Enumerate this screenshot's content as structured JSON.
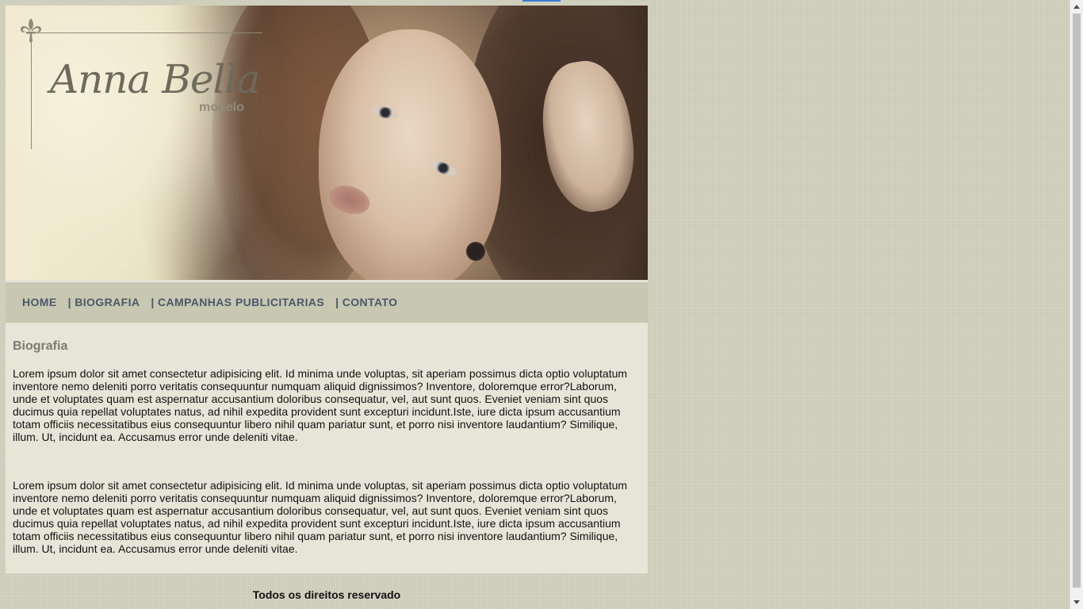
{
  "banner": {
    "brand_name": "Anna Bella",
    "brand_subtitle": "modelo",
    "image_alt": "Model portrait"
  },
  "nav": {
    "items": [
      {
        "label": "HOME"
      },
      {
        "label": "| BIOGRAFIA"
      },
      {
        "label": "| CAMPANHAS PUBLICITARIAS"
      },
      {
        "label": "| CONTATO"
      }
    ]
  },
  "content": {
    "heading": "Biografia",
    "paragraphs": [
      "Lorem ipsum dolor sit amet consectetur adipisicing elit. Id minima unde voluptas, sit aperiam possimus dicta optio voluptatum inventore nemo deleniti porro veritatis consequuntur numquam aliquid dignissimos? Inventore, doloremque error?Laborum, unde et voluptates quam est aspernatur accusantium doloribus consequatur, vel, aut sunt quos. Eveniet veniam sint quos ducimus quia repellat voluptates natus, ad nihil expedita provident sunt excepturi incidunt.Iste, iure dicta ipsum accusantium totam officiis necessitatibus eius consequuntur libero nihil quam pariatur sunt, et porro nisi inventore laudantium? Similique, illum. Ut, incidunt ea. Accusamus error unde deleniti vitae.",
      "Lorem ipsum dolor sit amet consectetur adipisicing elit. Id minima unde voluptas, sit aperiam possimus dicta optio voluptatum inventore nemo deleniti porro veritatis consequuntur numquam aliquid dignissimos? Inventore, doloremque error?Laborum, unde et voluptates quam est aspernatur accusantium doloribus consequatur, vel, aut sunt quos. Eveniet veniam sint quos ducimus quia repellat voluptates natus, ad nihil expedita provident sunt excepturi incidunt.Iste, iure dicta ipsum accusantium totam officiis necessitatibus eius consequuntur libero nihil quam pariatur sunt, et porro nisi inventore laudantium? Similique, illum. Ut, incidunt ea. Accusamus error unde deleniti vitae."
    ]
  },
  "footer": {
    "text": "Todos os direitos reservado"
  },
  "colors": {
    "page_background": "#d4d4c2",
    "nav_background": "#c7c7b2",
    "nav_text": "#4b5868",
    "content_background": "#e6e6d8",
    "heading_text": "#7d7a6e",
    "logo_text": "#6e6a5c"
  },
  "icons": {
    "logo_ornament": "fleur-de-lis-icon",
    "scroll_up": "scroll-up-arrow-icon",
    "scroll_down": "scroll-down-arrow-icon"
  }
}
